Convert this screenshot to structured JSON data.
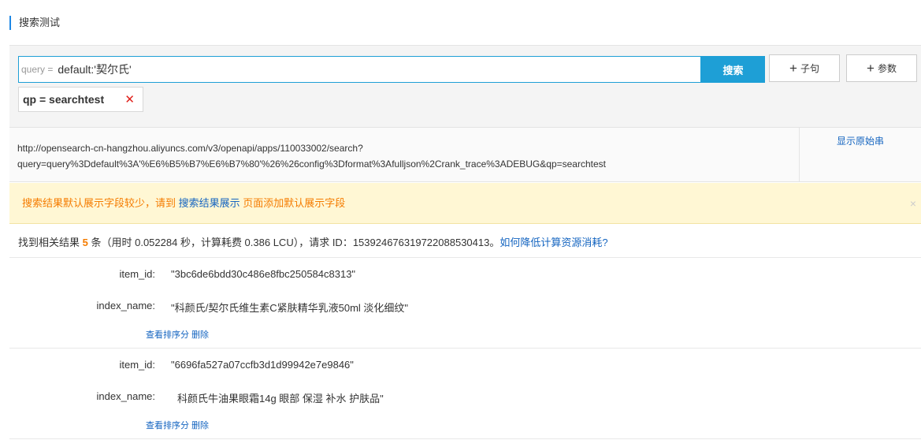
{
  "section": {
    "title": "搜索测试"
  },
  "search": {
    "query_prefix": "query =",
    "query_value": "default:'契尔氏'",
    "search_button": "搜索",
    "add_clause_button": "子句",
    "add_param_button": "参数",
    "param_tag": "qp = searchtest"
  },
  "url": {
    "line1": "http://opensearch-cn-hangzhou.aliyuncs.com/v3/openapi/apps/110033002/search?",
    "line2": "query=query%3Ddefault%3A'%E6%B5%B7%E6%B7%80'%26%26config%3Dformat%3Afulljson%2Crank_trace%3ADEBUG&qp=searchtest",
    "show_raw": "显示原始串"
  },
  "notice": {
    "text_before": "搜索结果默认展示字段较少，请到",
    "link": "搜索结果展示",
    "text_after": "页面添加默认展示字段",
    "close": "×"
  },
  "summary": {
    "prefix": "找到相关结果",
    "count": "5",
    "details": "条（用时 0.052284 秒，计算耗费 0.386 LCU），请求 ID：153924676319722088530413。",
    "help_link": "如何降低计算资源消耗?"
  },
  "results": [
    {
      "item_id_label": "item_id:",
      "item_id_value": "\"3bc6de6bdd30c486e8fbc250584c8313\"",
      "index_name_label": "index_name:",
      "index_name_value": "\"科颜氏/契尔氏维生素C紧肤精华乳液50ml 淡化细纹\"",
      "view_score": "查看排序分",
      "delete": "删除"
    },
    {
      "item_id_label": "item_id:",
      "item_id_value": "\"6696fa527a07ccfb3d1d99942e7e9846\"",
      "index_name_label": "index_name:",
      "index_name_value": "科颜氏牛油果眼霜14g 眼部 保湿 补水 护肤品\"",
      "view_score": "查看排序分",
      "delete": "删除"
    }
  ],
  "colors": {
    "primary": "#1e9fd6",
    "link": "#1565c0",
    "warning": "#f57c00",
    "notice_bg": "#fff7d4",
    "danger": "#e0201b"
  }
}
